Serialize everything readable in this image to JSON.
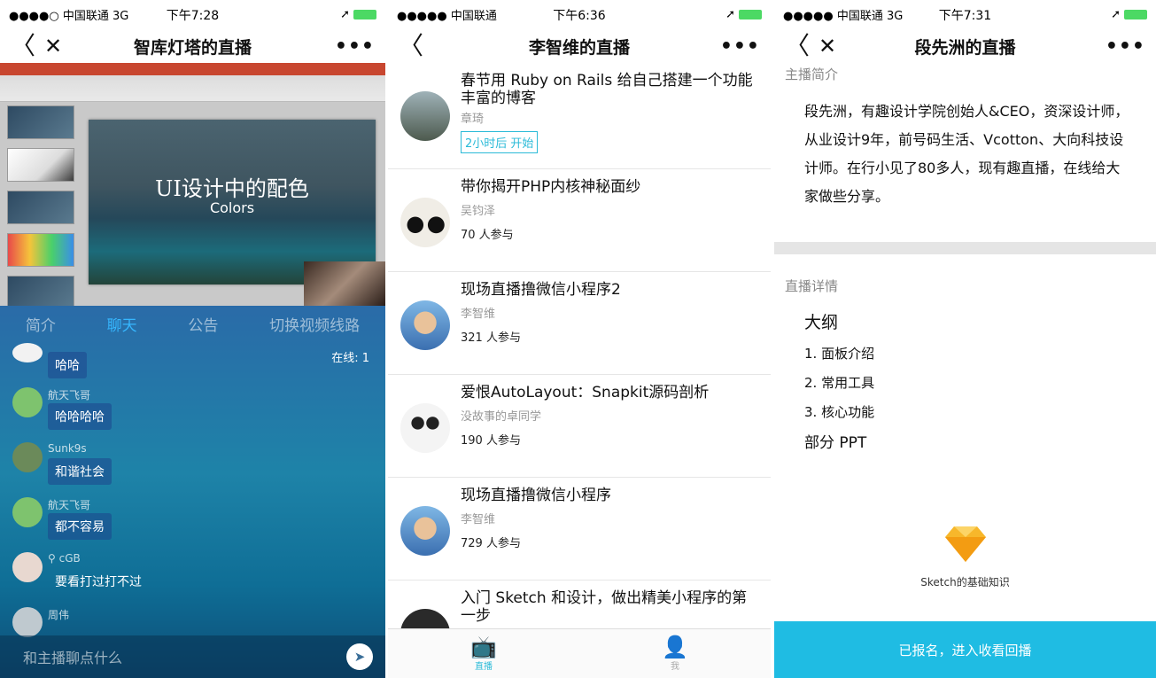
{
  "phone1": {
    "status": {
      "carrier": "●●●●○ 中国联通  3G",
      "time": "下午7:28"
    },
    "nav": {
      "back": "〈",
      "close": "✕",
      "title": "智库灯塔的直播",
      "more": "•••"
    },
    "slide": {
      "title": "UI设计中的配色",
      "subtitle": "Colors"
    },
    "tabs": [
      "简介",
      "聊天",
      "公告",
      "切换视频线路"
    ],
    "online": "在线: 1",
    "messages": [
      {
        "name": "",
        "text": "哈哈"
      },
      {
        "name": "航天飞哥",
        "text": "哈哈哈哈"
      },
      {
        "name": "Sunk9s",
        "text": "和谐社会"
      },
      {
        "name": "航天飞哥",
        "text": "都不容易"
      },
      {
        "name": "cGB",
        "text": "要看打过打不过"
      },
      {
        "name": "周伟",
        "text": ""
      }
    ],
    "input_placeholder": "和主播聊点什么"
  },
  "phone2": {
    "status": {
      "carrier": "●●●●● 中国联通",
      "time": "下午6:36"
    },
    "nav": {
      "back": "〈",
      "title": "李智维的直播",
      "more": "•••"
    },
    "items": [
      {
        "title": "春节用 Ruby on Rails 给自己搭建一个功能丰富的博客",
        "author": "章琦",
        "badge": "2小时后 开始",
        "count": ""
      },
      {
        "title": "带你揭开PHP内核神秘面纱",
        "author": "吴钧泽",
        "badge": "",
        "count": "70 人参与"
      },
      {
        "title": "现场直播撸微信小程序2",
        "author": "李智维",
        "badge": "",
        "count": "321 人参与"
      },
      {
        "title": "爱恨AutoLayout：Snapkit源码剖析",
        "author": "没故事的卓同学",
        "badge": "",
        "count": "190 人参与"
      },
      {
        "title": "现场直播撸微信小程序",
        "author": "李智维",
        "badge": "",
        "count": "729 人参与"
      },
      {
        "title": "入门 Sketch 和设计，做出精美小程序的第一步",
        "author": "",
        "badge": "",
        "count": ""
      }
    ],
    "tabbar": {
      "live": "直播",
      "me": "我"
    }
  },
  "phone3": {
    "status": {
      "carrier": "●●●●● 中国联通  3G",
      "time": "下午7:31"
    },
    "nav": {
      "back": "〈",
      "close": "✕",
      "title": "段先洲的直播",
      "more": "•••"
    },
    "intro_label": "主播简介",
    "intro": "段先洲，有趣设计学院创始人&CEO，资深设计师，从业设计9年，前号码生活、Vcotton、大向科技设计师。在行小见了80多人，现有趣直播，在线给大家做些分享。",
    "detail_label": "直播详情",
    "outline_title": "大纲",
    "outline": [
      "1. 面板介绍",
      "2. 常用工具",
      "3. 核心功能"
    ],
    "outline_footer": "部分 PPT",
    "sketch_caption": "Sketch的基础知识",
    "cta": "已报名，进入收看回播"
  }
}
